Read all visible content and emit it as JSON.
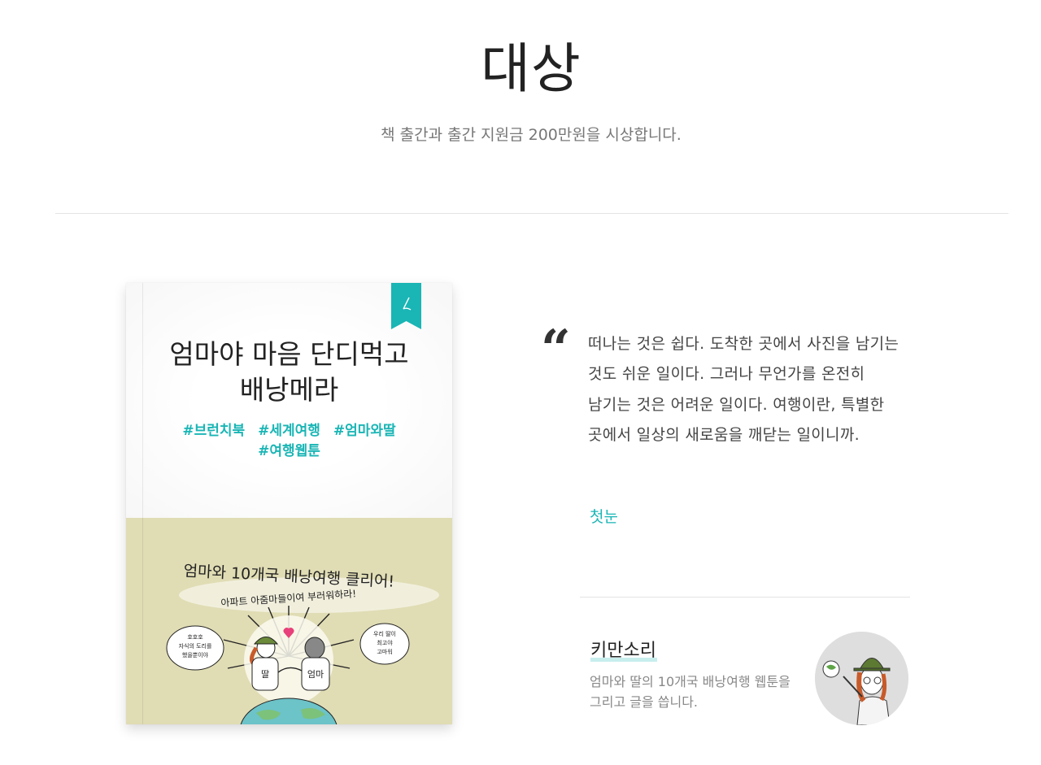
{
  "section": {
    "title": "대상",
    "subtitle": "책 출간과 출간 지원금 200만원을 시상합니다."
  },
  "book": {
    "title_line1": "엄마야 마음 단디먹고",
    "title_line2": "배낭메라",
    "tags": [
      "#브런치북",
      "#세계여행",
      "#엄마와딸",
      "#여행웹툰"
    ],
    "illustration": {
      "headline": "엄마와 10개국 배낭여행 클리어!",
      "subline": "아파트 아줌마들이여 부러워하라!",
      "bubble_left": "호호호\n자식의 도리를\n했을뿐이야",
      "bubble_right": "우리 딸이\n최고야\n고마워",
      "label_daughter": "딸",
      "label_mom": "엄마"
    },
    "accent_color": "#1ab5b5",
    "cover_color": "#e0dcb4"
  },
  "quote": {
    "mark": "“",
    "text": "떠나는 것은 쉽다. 도착한 곳에서 사진을 남기는 것도 쉬운 일이다. 그러나 무언가를 온전히 남기는 것은 어려운 일이다. 여행이란, 특별한 곳에서 일상의 새로움을 깨닫는 일이니까.",
    "author": "첫눈"
  },
  "writer": {
    "name": "키만소리",
    "bio": "엄마와 딸의 10개국 배낭여행 웹툰을 그리고 글을 씁니다.",
    "avatar_icon": "hat-character-avatar"
  }
}
